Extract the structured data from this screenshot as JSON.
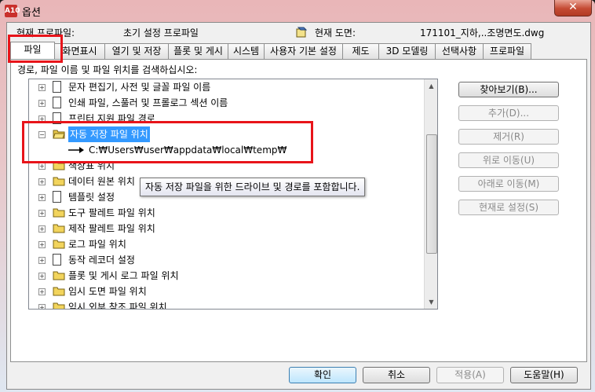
{
  "window": {
    "title": "옵션",
    "app_icon": "A10",
    "close_glyph": "✕"
  },
  "header": {
    "profile_label": "현재 프로파일:",
    "profile_value": "초기 설정 프로파일",
    "drawing_label": "현재 도면:",
    "drawing_value": "171101_지하,..조명면도.dwg"
  },
  "tabs": [
    "파일",
    "화면표시",
    "열기 및 저장",
    "플롯 및 게시",
    "시스템",
    "사용자 기본 설정",
    "제도",
    "3D 모델링",
    "선택사항",
    "프로파일"
  ],
  "panel": {
    "hint": "경로, 파일 이름 및 파일 위치를 검색하십시오:",
    "tree": [
      {
        "label": "문자 편집기, 사전 및 글꼴 파일 이름",
        "icon": "file-icon",
        "expander": "+"
      },
      {
        "label": "인쇄 파일, 스풀러 및 프롤로그 섹션 이름",
        "icon": "file-icon",
        "expander": "+"
      },
      {
        "label": "프린터 지원 파일 경로",
        "icon": "file-icon",
        "expander": "+"
      },
      {
        "label": "자동 저장 파일 위치",
        "icon": "folder-icon",
        "expander": "−",
        "selected": true
      },
      {
        "label": "C:₩Users₩user₩appdata₩local₩temp₩",
        "icon": "arrow-icon",
        "child": true
      },
      {
        "label": "색상표 위치",
        "icon": "folder-icon",
        "expander": "+"
      },
      {
        "label": "데이터 원본 위치",
        "icon": "folder-icon",
        "expander": "+"
      },
      {
        "label": "템플릿 설정",
        "icon": "file-icon",
        "expander": "+"
      },
      {
        "label": "도구 팔레트 파일 위치",
        "icon": "folder-icon",
        "expander": "+"
      },
      {
        "label": "제작 팔레트 파일 위치",
        "icon": "folder-icon",
        "expander": "+"
      },
      {
        "label": "로그 파일 위치",
        "icon": "folder-icon",
        "expander": "+"
      },
      {
        "label": "동작 레코더 설정",
        "icon": "file-icon",
        "expander": "+"
      },
      {
        "label": "플롯 및 게시 로그 파일 위치",
        "icon": "folder-icon",
        "expander": "+"
      },
      {
        "label": "임시 도면 파일 위치",
        "icon": "folder-icon",
        "expander": "+"
      },
      {
        "label": "임시 외부 참조 파일 위치",
        "icon": "folder-icon",
        "expander": "+"
      }
    ],
    "tooltip": "자동 저장 파일을 위한 드라이브 및 경로를 포함합니다.",
    "buttons": {
      "browse": "찾아보기(B)...",
      "add": "추가(D)...",
      "remove": "제거(R)",
      "move_up": "위로 이동(U)",
      "move_down": "아래로 이동(M)",
      "set_current": "현재로 설정(S)"
    }
  },
  "footer": {
    "ok": "확인",
    "cancel": "취소",
    "apply": "적용(A)",
    "help": "도움말(H)"
  },
  "colors": {
    "selection": "#3399ff",
    "highlight": "#e8141a",
    "tab_active": "#ffffff"
  }
}
